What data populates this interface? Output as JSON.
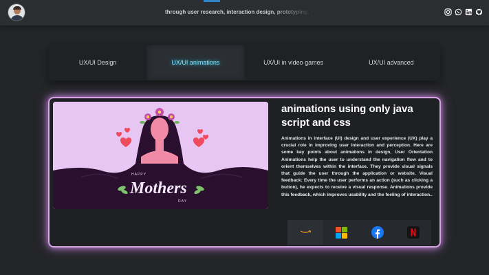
{
  "header": {
    "marquee_text": "through user research, interaction design, prototyping, us",
    "avatar": "profile-photo",
    "social_icons": [
      "instagram-icon",
      "whatsapp-icon",
      "linkedin-icon",
      "github-icon"
    ]
  },
  "tabs": [
    {
      "label": "UX/UI Design",
      "active": false
    },
    {
      "label": "UX/UI animations",
      "active": true
    },
    {
      "label": "UX/UI in video games",
      "active": false
    },
    {
      "label": "UX/UI advanced",
      "active": false
    }
  ],
  "card": {
    "title": "animations using only java script and css",
    "body": "Animations in interface (UI) design and user experience (UX) play a crucial role in improving user interaction and perception. Here are some key points about animations in design, User Orientation Animations help the user to understand the navigation flow and to orient themselves within the interface. They provide visual signals that guide the user through the application or website. Visual feedback: Every time the user performs an action (such as clicking a button), he expects to receive a visual response. Animations provide this feedback, which improves usability and the feeling of interaction..",
    "image": {
      "happy": "HAPPY",
      "mothers": "Mothers",
      "day": "DAY"
    },
    "brands": [
      "amazon-logo",
      "microsoft-logo",
      "facebook-logo",
      "netflix-logo"
    ]
  },
  "colors": {
    "background": "#232528",
    "active_tab": "#7fe4ff",
    "card_glow": "#d7a4e4",
    "illustration_bg": "#e8c6f3",
    "hair": "#2a0f2e"
  }
}
